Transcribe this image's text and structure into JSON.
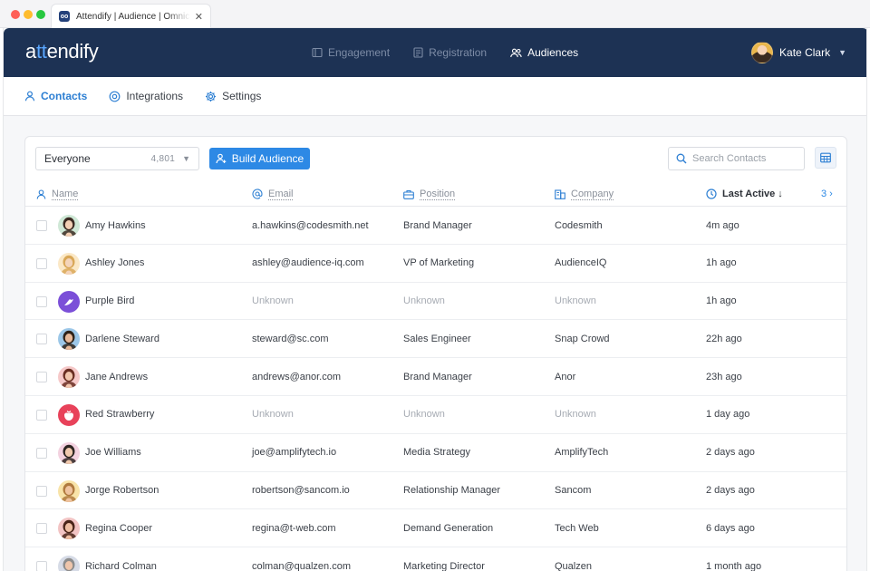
{
  "browser": {
    "tab_title": "Attendify | Audience | Omnichannel",
    "favicon_text": "oo"
  },
  "app": {
    "logo_prefix": "a",
    "logo_accent": "tt",
    "logo_suffix": "endify",
    "nav": [
      {
        "label": "Engagement",
        "icon": "engagement-icon"
      },
      {
        "label": "Registration",
        "icon": "registration-icon"
      },
      {
        "label": "Audiences",
        "icon": "audiences-icon",
        "active": true
      }
    ],
    "user": {
      "name": "Kate Clark"
    },
    "subnav": [
      {
        "label": "Contacts",
        "active": true
      },
      {
        "label": "Integrations"
      },
      {
        "label": "Settings"
      }
    ]
  },
  "toolbar": {
    "segment_label": "Everyone",
    "segment_count": "4,801",
    "build_label": "Build Audience",
    "search_placeholder": "Search Contacts"
  },
  "table": {
    "headers": {
      "name": "Name",
      "email": "Email",
      "position": "Position",
      "company": "Company",
      "last_active": "Last Active",
      "sort_arrow": "↓",
      "more_count": "3"
    },
    "rows": [
      {
        "name": "Amy Hawkins",
        "email": "a.hawkins@codesmith.net",
        "position": "Brand Manager",
        "company": "Codesmith",
        "last_active": "4m ago",
        "avatar": "photo",
        "skin": "#f2cfb4",
        "hair": "#3b2a22",
        "bg": "#cfe8d6"
      },
      {
        "name": "Ashley Jones",
        "email": "ashley@audience-iq.com",
        "position": "VP of Marketing",
        "company": "AudienceIQ",
        "last_active": "1h ago",
        "avatar": "photo",
        "skin": "#f4d4ba",
        "hair": "#d9a757",
        "bg": "#fbe8c6"
      },
      {
        "name": "Purple Bird",
        "email": "Unknown",
        "position": "Unknown",
        "company": "Unknown",
        "last_active": "1h ago",
        "avatar": "bird",
        "unknown": true
      },
      {
        "name": "Darlene Steward",
        "email": "steward@sc.com",
        "position": "Sales Engineer",
        "company": "Snap Crowd",
        "last_active": "22h ago",
        "avatar": "photo",
        "skin": "#e8b999",
        "hair": "#2e2219",
        "bg": "#9cc7e8"
      },
      {
        "name": "Jane Andrews",
        "email": "andrews@anor.com",
        "position": "Brand Manager",
        "company": "Anor",
        "last_active": "23h ago",
        "avatar": "photo",
        "skin": "#f1c6ad",
        "hair": "#6a2e22",
        "bg": "#f6c9c9"
      },
      {
        "name": "Red Strawberry",
        "email": "Unknown",
        "position": "Unknown",
        "company": "Unknown",
        "last_active": "1 day ago",
        "avatar": "strawberry",
        "unknown": true
      },
      {
        "name": "Joe Williams",
        "email": "joe@amplifytech.io",
        "position": "Media Strategy",
        "company": "AmplifyTech",
        "last_active": "2 days ago",
        "avatar": "photo",
        "skin": "#f0c9ae",
        "hair": "#2d2521",
        "bg": "#f3d2e0"
      },
      {
        "name": "Jorge Robertson",
        "email": "robertson@sancom.io",
        "position": "Relationship Manager",
        "company": "Sancom",
        "last_active": "2 days ago",
        "avatar": "photo",
        "skin": "#efc39f",
        "hair": "#b07a3e",
        "bg": "#f8e3a8"
      },
      {
        "name": "Regina Cooper",
        "email": "regina@t-web.com",
        "position": "Demand Generation",
        "company": "Tech Web",
        "last_active": "6 days ago",
        "avatar": "photo",
        "skin": "#eebda2",
        "hair": "#4a2419",
        "bg": "#f2c4c4"
      },
      {
        "name": "Richard Colman",
        "email": "colman@qualzen.com",
        "position": "Marketing Director",
        "company": "Qualzen",
        "last_active": "1 month ago",
        "avatar": "photo",
        "skin": "#eec5ab",
        "hair": "#8d8d8d",
        "bg": "#d6dbe6"
      }
    ]
  }
}
